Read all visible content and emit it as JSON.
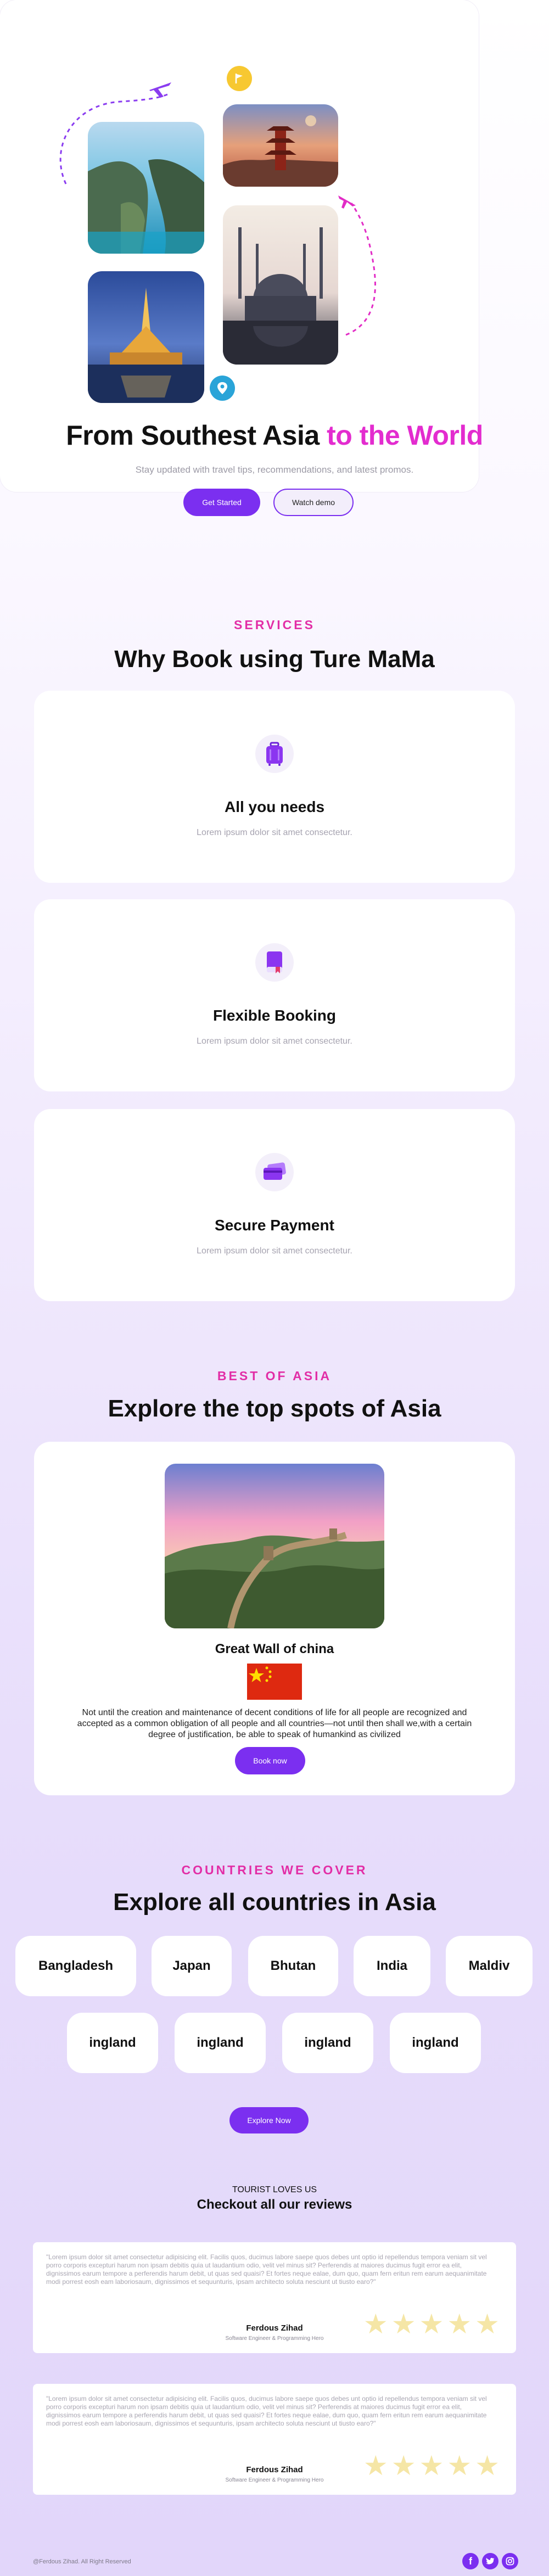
{
  "hero": {
    "title_main": "From Southest Asia",
    "title_accent": "to the World",
    "subtitle": "Stay updated with travel tips, recommendations, and latest promos.",
    "primary_button": "Get Started",
    "secondary_button": "Watch demo"
  },
  "services": {
    "eyebrow": "SERVICES",
    "heading": "Why Book using Ture MaMa",
    "items": [
      {
        "title": "All you needs",
        "desc": "Lorem ipsum dolor sit amet consectetur.",
        "icon": "suitcase-icon"
      },
      {
        "title": "Flexible Booking",
        "desc": "Lorem ipsum dolor sit amet consectetur.",
        "icon": "booking-book-icon"
      },
      {
        "title": "Secure Payment",
        "desc": "Lorem ipsum dolor sit amet consectetur.",
        "icon": "credit-card-icon"
      }
    ]
  },
  "spots": {
    "eyebrow": "BEST OF ASIA",
    "heading": "Explore the top spots of Asia",
    "place": "Great Wall of china",
    "description": "Not until the creation and maintenance of decent conditions of life for all people are recognized and accepted as a common obligation of all people and all countries—not until then shall we,with a certain degree of justification, be able to speak of humankind as civilized",
    "button": "Book now"
  },
  "countries": {
    "eyebrow": "COUNTRIES WE COVER",
    "heading": "Explore all countries in Asia",
    "row1": [
      "Bangladesh",
      "Japan",
      "Bhutan",
      "India",
      "Maldiv"
    ],
    "row2": [
      "ingland",
      "ingland",
      "ingland",
      "ingland"
    ],
    "button": "Explore Now"
  },
  "reviews": {
    "eyebrow": "TOURIST LOVES US",
    "heading": "Checkout all our reviews",
    "items": [
      {
        "text": "\"Lorem ipsum dolor sit amet consectetur adipisicing elit. Facilis quos, ducimus labore saepe quos debes unt optio id repellendus tempora veniam sit vel porro corporis excepturi harum non ipsam debitis quia ut laudantium odio, velit vel minus sit? Perferendis at maiores ducimus fugit error ea elit, dignissimos earum tempore a perferendis harum debit, ut quas sed quaisi? Et fortes neque ealae, dum quo, quam fern eritun rem earum aequanimitate modi porrest eosh eam laboriosaum, dignissimos et sequunturis, ipsam architecto soluta nesciunt ut tiusto earo?\"",
        "name": "Ferdous Zihad",
        "role": "Software Engineer & Programming Hero",
        "rating": 5
      },
      {
        "text": "\"Lorem ipsum dolor sit amet consectetur adipisicing elit. Facilis quos, ducimus labore saepe quos debes unt optio id repellendus tempora veniam sit vel porro corporis excepturi harum non ipsam debitis quia ut laudantium odio, velit vel minus sit? Perferendis at maiores ducimus fugit error ea elit, dignissimos earum tempore a perferendis harum debit, ut quas sed quaisi? Et fortes neque ealae, dum quo, quam fern eritun rem earum aequanimitate modi porrest eosh eam laboriosaum, dignissimos et sequunturis, ipsam architecto soluta nesciunt ut tiusto earo?\"",
        "name": "Ferdous Zihad",
        "role": "Software Engineer & Programming Hero",
        "rating": 5
      }
    ]
  },
  "footer": {
    "copyright": "@Ferdous Zihad. All Right Reserved",
    "social": [
      "facebook-icon",
      "twitter-icon",
      "instagram-icon"
    ]
  },
  "colors": {
    "accent": "#7b2ff0",
    "pink": "#e32ccf",
    "eyebrow": "#e22ea6"
  }
}
